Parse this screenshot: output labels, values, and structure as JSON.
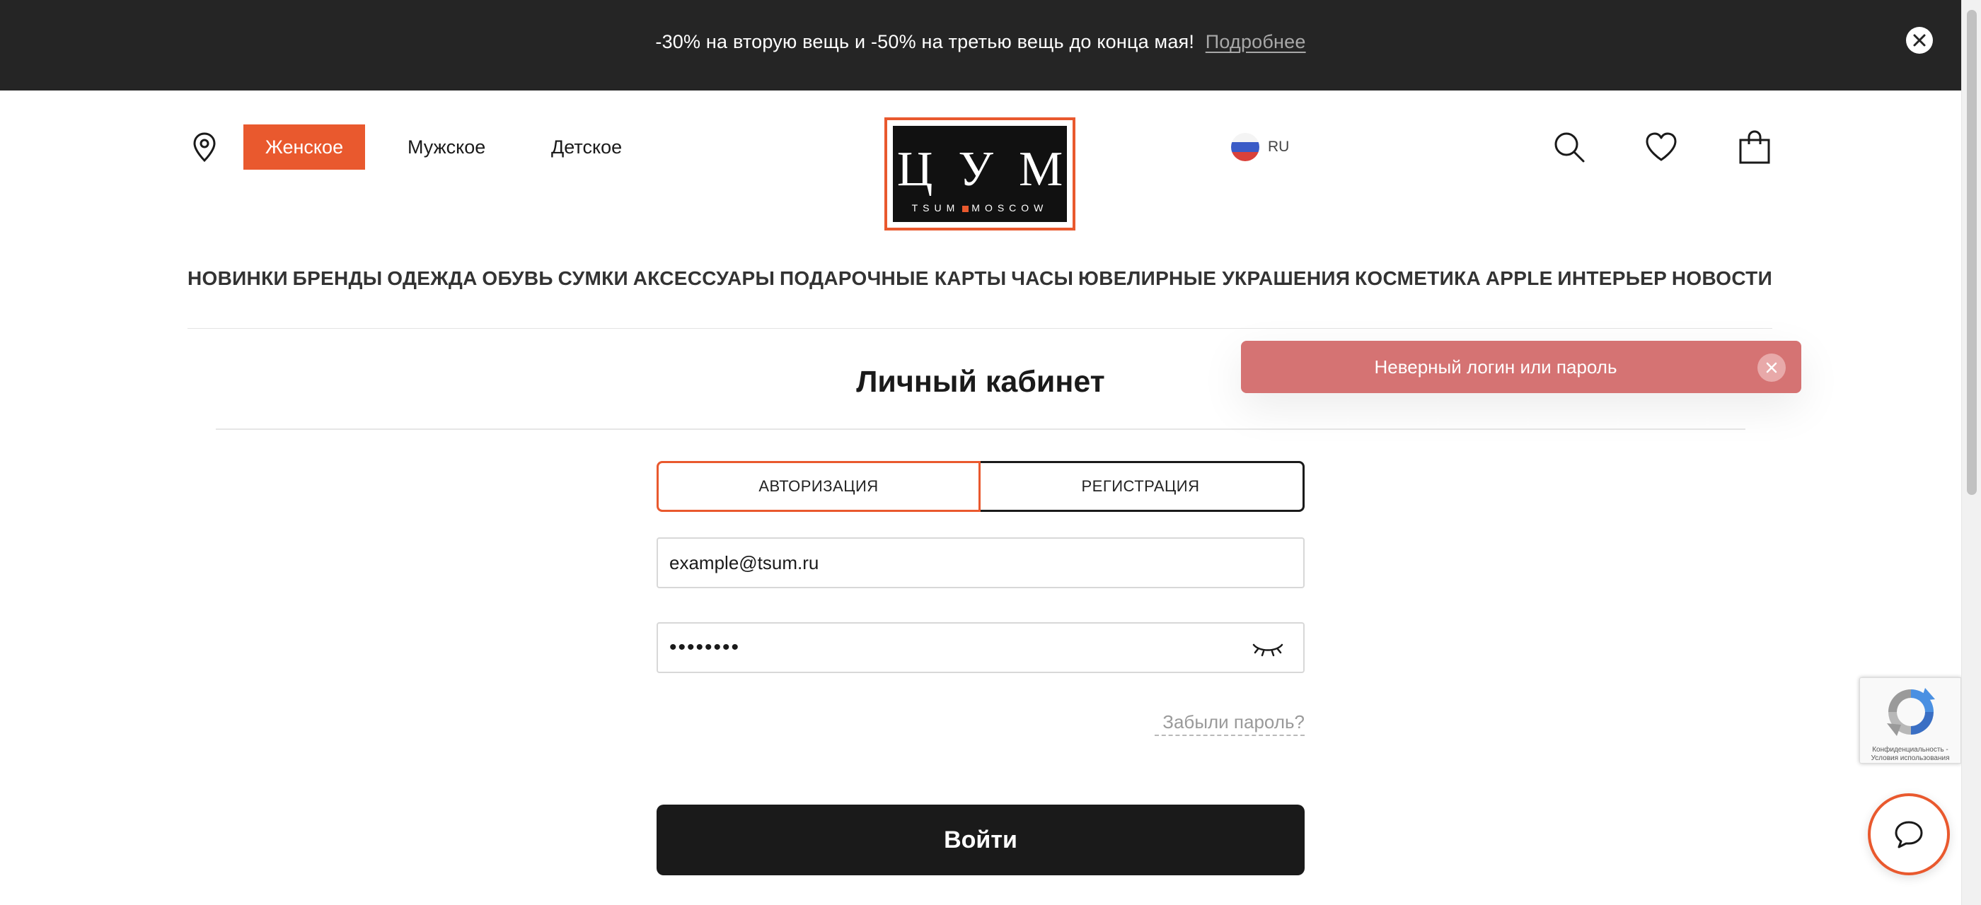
{
  "promo": {
    "text": "-30% на вторую вещь и -50% на третью вещь до конца мая!",
    "link": "Подробнее"
  },
  "header": {
    "gender_tabs": [
      "Женское",
      "Мужское",
      "Детское"
    ],
    "logo": {
      "letters": [
        "Ц",
        "У",
        "М"
      ],
      "sub_left": "TSUM",
      "sub_right": "MOSCOW"
    },
    "language": "RU"
  },
  "categories": [
    "НОВИНКИ",
    "БРЕНДЫ",
    "ОДЕЖДА",
    "ОБУВЬ",
    "СУМКИ",
    "АКСЕССУАРЫ",
    "ПОДАРОЧНЫЕ КАРТЫ",
    "ЧАСЫ",
    "ЮВЕЛИРНЫЕ УКРАШЕНИЯ",
    "КОСМЕТИКА",
    "APPLE",
    "ИНТЕРЬЕР",
    "НОВОСТИ"
  ],
  "page": {
    "title": "Личный кабинет"
  },
  "toast": {
    "message": "Неверный логин или пароль"
  },
  "auth": {
    "tab_login": "АВТОРИЗАЦИЯ",
    "tab_register": "РЕГИСТРАЦИЯ",
    "email_value": "example@tsum.ru",
    "password_value": "••••••••",
    "forgot": "Забыли пароль?",
    "submit": "Войти"
  },
  "recaptcha": {
    "text": "Конфиденциальность - Условия использования"
  },
  "colors": {
    "accent": "#e9592e",
    "banner_bg": "#252525",
    "toast_bg": "#d57373",
    "button_bg": "#1a1a1a"
  }
}
